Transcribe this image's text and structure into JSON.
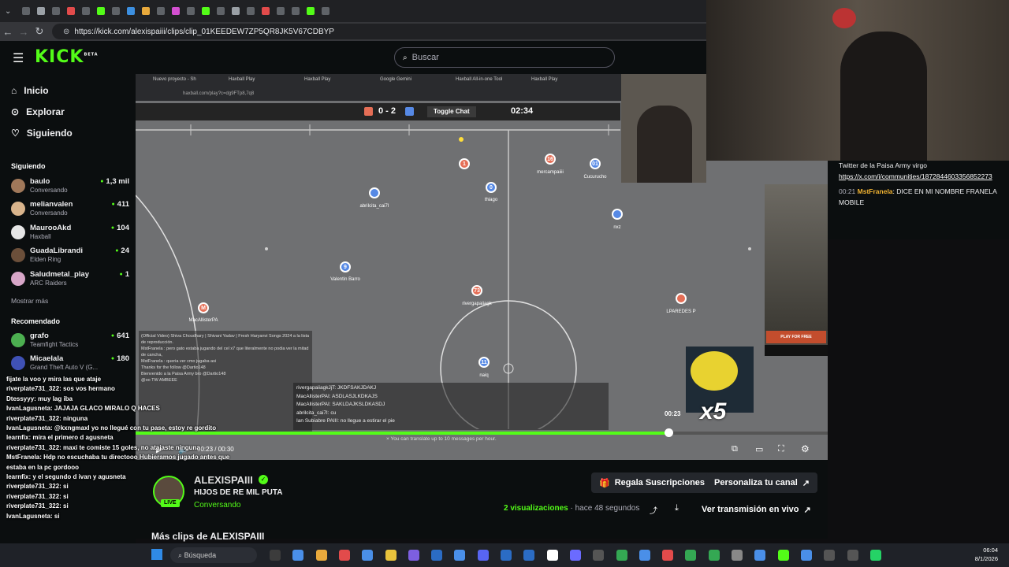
{
  "browser": {
    "url": "https://kick.com/alexispaiii/clips/clip_01KEEDEW7ZP5QR8JK5V67CDBYP"
  },
  "header": {
    "logo": "KICK",
    "logo_badge": "BETA",
    "search_placeholder": "Buscar"
  },
  "sidebar": {
    "nav": [
      {
        "label": "Inicio",
        "icon": "home-icon"
      },
      {
        "label": "Explorar",
        "icon": "compass-icon"
      },
      {
        "label": "Siguiendo",
        "icon": "heart-icon"
      }
    ],
    "following_title": "Siguiendo",
    "following": [
      {
        "name": "baulo",
        "game": "Conversando",
        "viewers": "1,3 mil",
        "color": "#a0785a"
      },
      {
        "name": "melianvalen",
        "game": "Conversando",
        "viewers": "411",
        "color": "#d9b48c"
      },
      {
        "name": "MaurooAkd",
        "game": "Haxball",
        "viewers": "104",
        "color": "#e6e6e6"
      },
      {
        "name": "GuadaLibrandi",
        "game": "Elden Ring",
        "viewers": "24",
        "color": "#6b4f3a"
      },
      {
        "name": "Saludmetal_play",
        "game": "ARC Raiders",
        "viewers": "1",
        "color": "#d7a6c8"
      }
    ],
    "show_more": "Mostrar más",
    "recommended_title": "Recomendado",
    "recommended": [
      {
        "name": "grafo",
        "game": "Teamfight Tactics",
        "viewers": "641",
        "color": "#4caf50"
      },
      {
        "name": "Micaelala",
        "game": "Grand Theft Auto V (G...",
        "viewers": "180",
        "color": "#3f51b5"
      }
    ]
  },
  "video": {
    "inner_tabs": [
      "Nuevo proyecto - Sh",
      "Haxball Play",
      "Haxball Play",
      "Google Gemini",
      "Haxball All-in-one Tool",
      "Haxball Play"
    ],
    "inner_url": "haxball.com/play?c=dg9FTp8,7q8",
    "score": "0 - 2",
    "toggle_chat": "Toggle Chat",
    "game_time": "02:34",
    "players": [
      {
        "num": "1",
        "team": "red",
        "name": ""
      },
      {
        "num": "16",
        "team": "red",
        "name": "mercampaiiii"
      },
      {
        "num": "01",
        "team": "blue",
        "name": "Cucurucho"
      },
      {
        "num": "0",
        "team": "blue",
        "name": "thiago"
      },
      {
        "num": "",
        "team": "blue",
        "name": "abriIcita_cai7I"
      },
      {
        "num": "",
        "team": "blue",
        "name": "nxz"
      },
      {
        "num": "9",
        "team": "blue",
        "name": "Valentin Barro"
      },
      {
        "num": "73",
        "team": "red",
        "name": "rivergapaiiagk"
      },
      {
        "num": "M",
        "team": "red",
        "name": "MacAllisterPA"
      },
      {
        "num": "",
        "team": "red",
        "name": "LPAREDES P"
      },
      {
        "num": "11",
        "team": "blue",
        "name": "naiq"
      }
    ],
    "game_chat": [
      "rivergapaiiagkJjT: JKDFSAKJDAKJ",
      "MacAllisterPAI: ASDLASJLKDKAJS",
      "MacAllisterPAI: SAKLDAJKSLDKASDJ",
      "abrilcita_cai7I: cu",
      "Ian Subiabre PAIII: no llegue a estirar el pie"
    ],
    "translate_note": "× You can translate up to 10 messages per hour.",
    "stream_chat": [
      "(Official Video) Shiva Choudhary | Shivani Yadav | Fresh Haryanvi Songs 2024 a la lista de reproducción.",
      "MstFranela : pero gato estaba jugando del cel x7 que literalmente no podia ver la mitad de cancha,",
      "MstFranela : queria ver cmo jugaba asi",
      "Thanks for the follow @Dartio148",
      "Bienvenido a la Paisa Army bro @Dartio148",
      "@oo TW AMBEEE"
    ],
    "timestamp": "00:23",
    "current_time": "00:23",
    "duration": "00:30",
    "progress": 0.77,
    "ad_label": "PLAY FOR FREE",
    "promo_label": "x5"
  },
  "right_chat": {
    "lines": [
      {
        "time": "",
        "user": "",
        "text": "Twitter de la Paisa Army virgo"
      },
      {
        "time": "",
        "user": "",
        "link": "https://x.com/i/communities/1872844603356852273"
      },
      {
        "time": "00:21",
        "user": "MstFranela",
        "text": ": DICE EN MI NOMBRE FRANELA MOBILE"
      }
    ]
  },
  "overlay_chat": [
    {
      "user": "",
      "text": "fijate la voo y mira las que ataje"
    },
    {
      "user": "riverplate731_322",
      "text": ": sos vos hermano"
    },
    {
      "user": "Dtessyyy",
      "text": ": muy lag iba"
    },
    {
      "user": "IvanLagusneta",
      "text": ": JAJAJA GLACO MIRALO Q HACES"
    },
    {
      "user": "riverplate731_322",
      "text": ": ninguna"
    },
    {
      "user": "IvanLagusneta",
      "text": ": @kxngmaxl yo no llegué con tu pase, estoy re gordito"
    },
    {
      "user": "learnfix",
      "text": ": mira el primero d agusneta"
    },
    {
      "user": "",
      "text": ""
    },
    {
      "user": "riverplate731_322",
      "text": ": maxi te comiste 15 goles, no atajaste ninguna"
    },
    {
      "user": "MstFranela",
      "text": ": Hdp no escuchaba tu directooo Hubieramos jugado antes que"
    },
    {
      "user": "",
      "text": "estaba en la pc gordooo"
    },
    {
      "user": "learnfix",
      "text": ": y el segundo d ivan y agusneta"
    },
    {
      "user": "riverplate731_322",
      "text": ": si"
    },
    {
      "user": "riverplate731_322",
      "text": ": si"
    },
    {
      "user": "",
      "text": ""
    },
    {
      "user": "riverplate731_322",
      "text": ": si"
    },
    {
      "user": "IvanLagusneta",
      "text": ": si"
    }
  ],
  "clip_info": {
    "streamer": "ALEXISPAIII",
    "title": "HIJOS DE RE MIL PUTA",
    "category": "Conversando",
    "live_badge": "LIVE",
    "views_count": "2",
    "views_label": "visualizaciones",
    "posted": "hace 48 segundos",
    "gift_button": "Regala Suscripciones",
    "customize_button": "Personaliza tu canal",
    "watch_live_button": "Ver transmisión en vivo",
    "more_clips": "Más clips de ALEXISPAIII"
  },
  "taskbar": {
    "search": "Búsqueda",
    "time": "06:04",
    "date": "8/1/2026"
  },
  "colors": {
    "accent": "#53fc18",
    "red_team": "#e56e56",
    "blue_team": "#5689e5"
  }
}
